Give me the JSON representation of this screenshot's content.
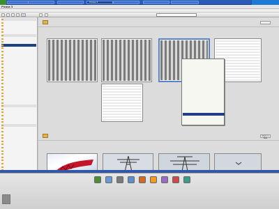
{
  "taskbar": {
    "start_label": "",
    "tasks": [
      "",
      "",
      "",
      "Picasa 3",
      "",
      "",
      ""
    ],
    "active_index": 3
  },
  "app": {
    "title": "Picasa 3"
  },
  "menubar": {
    "items": [
      "",
      "",
      "",
      "",
      "",
      ""
    ]
  },
  "sidebar": {
    "rows": [
      "",
      "",
      "",
      "",
      "",
      "",
      "",
      "",
      "",
      "",
      "",
      "",
      "",
      "",
      "",
      "",
      "",
      "",
      "",
      "",
      "",
      "",
      "",
      "",
      "",
      "",
      "",
      "",
      "",
      "",
      "",
      "",
      "",
      "",
      "",
      "",
      "",
      "",
      "",
      "",
      "",
      "",
      "",
      "",
      "",
      "",
      "",
      "",
      "",
      "",
      "",
      ""
    ],
    "selected_index": 8
  },
  "folders": [
    {
      "name": "",
      "subtitle": "",
      "share_label": ""
    },
    {
      "name": "",
      "subtitle": "",
      "share_label": "Share in Web"
    }
  ],
  "context_menu": {
    "highlighted_index": 20,
    "items": [
      "",
      "",
      "",
      "",
      "",
      "",
      "",
      "",
      "",
      "",
      "",
      "",
      "",
      "",
      "",
      "",
      "",
      "",
      "",
      "",
      "",
      "",
      "",
      "",
      ""
    ]
  },
  "bottom_bar": {
    "labels": [
      "",
      "",
      "",
      "",
      "",
      ""
    ]
  },
  "actions": [
    {
      "icon": "upload-icon",
      "label": ""
    },
    {
      "icon": "email-icon",
      "label": ""
    },
    {
      "icon": "print-icon",
      "label": ""
    },
    {
      "icon": "export-icon",
      "label": ""
    },
    {
      "icon": "shop-icon",
      "label": ""
    },
    {
      "icon": "blog-icon",
      "label": ""
    },
    {
      "icon": "collage-icon",
      "label": ""
    },
    {
      "icon": "movie-icon",
      "label": ""
    },
    {
      "icon": "geotag-icon",
      "label": ""
    }
  ],
  "colors": {
    "selection": "#213d87",
    "taskbar": "#2b5bb8",
    "folder": "#e2b351"
  }
}
